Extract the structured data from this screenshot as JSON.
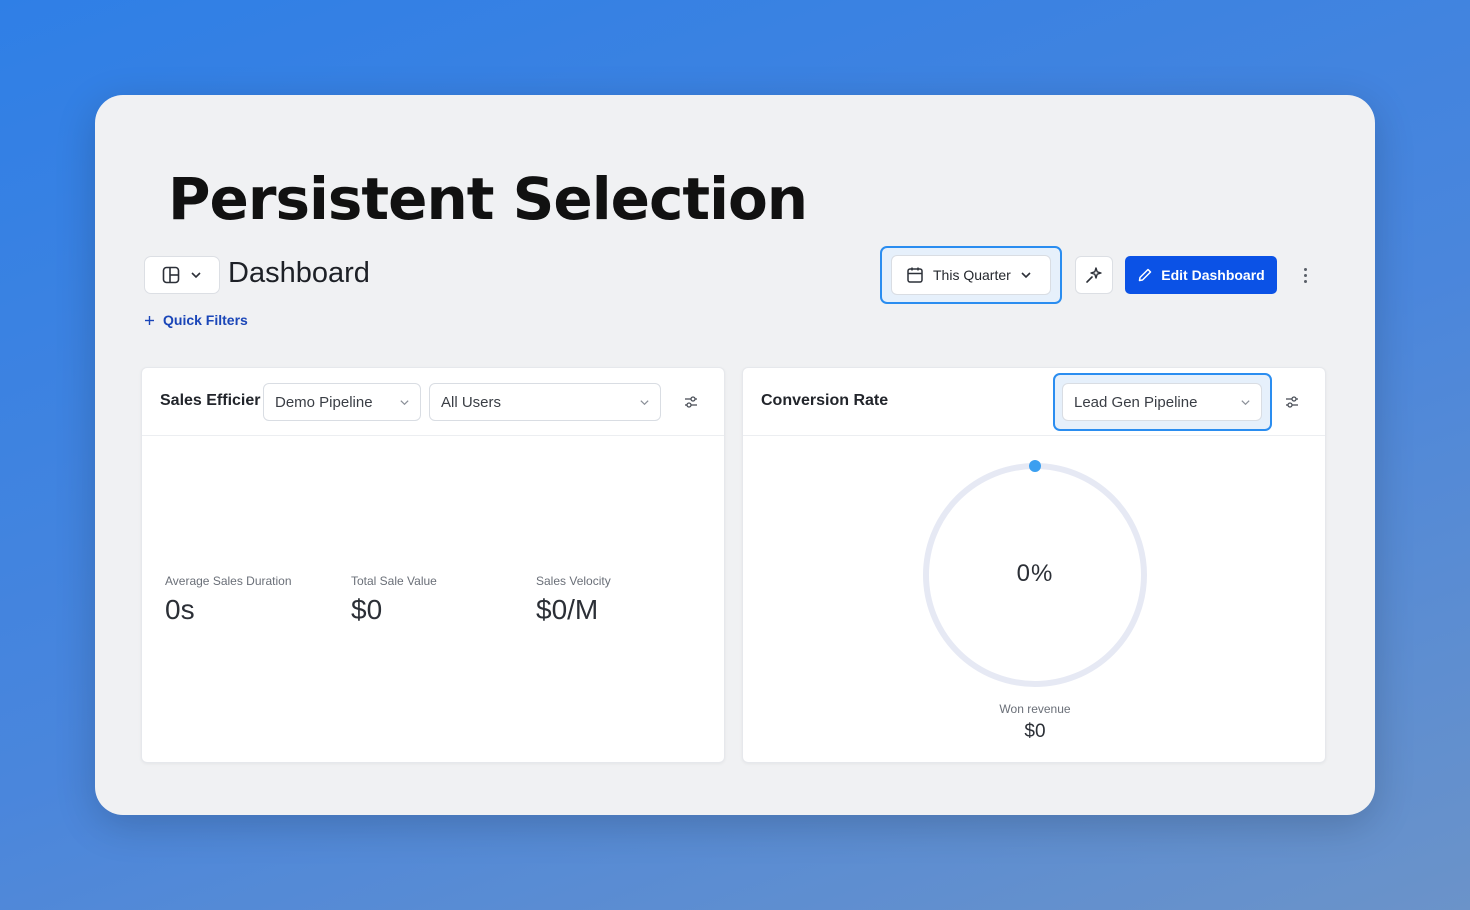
{
  "headline": "Persistent Selection",
  "header": {
    "title": "Dashboard",
    "quick_filters": "Quick Filters",
    "period": "This Quarter",
    "edit_label": "Edit Dashboard"
  },
  "sales_panel": {
    "title": "Sales Efficier",
    "pipeline": "Demo Pipeline",
    "users": "All Users",
    "metrics": [
      {
        "label": "Average Sales Duration",
        "value": "0s"
      },
      {
        "label": "Total Sale Value",
        "value": "$0"
      },
      {
        "label": "Sales Velocity",
        "value": "$0/M"
      }
    ]
  },
  "conversion_panel": {
    "title": "Conversion Rate",
    "pipeline": "Lead Gen Pipeline",
    "percent_label": "0%",
    "percent_value": 0,
    "won_label": "Won revenue",
    "won_value": "$0"
  },
  "colors": {
    "accent": "#0b52e6",
    "focus_ring": "#2a8df0",
    "gauge_track": "#e6e9f4",
    "gauge_dot": "#3b9ff0"
  }
}
